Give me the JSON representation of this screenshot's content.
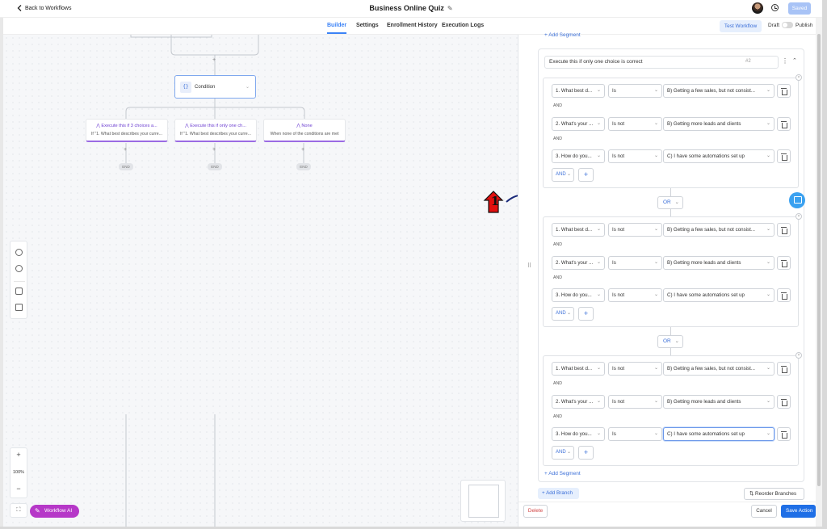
{
  "header": {
    "back_label": "Back to Workflows",
    "title": "Business Online Quiz",
    "saved_label": "Saved"
  },
  "tabs": [
    {
      "label": "Builder",
      "active": true
    },
    {
      "label": "Settings",
      "active": false
    },
    {
      "label": "Enrollment History",
      "active": false
    },
    {
      "label": "Execution Logs",
      "active": false
    }
  ],
  "toolbar": {
    "test_workflow": "Test Workflow",
    "draft": "Draft",
    "publish": "Publish",
    "publish_on": false
  },
  "canvas": {
    "condition_node": {
      "icon": "{}",
      "label": "Condition"
    },
    "branches": [
      {
        "title": "Execute this if 3 choices a...",
        "subtitle": "If \"1. What best describes your curre..."
      },
      {
        "title": "Execute this if only one ch...",
        "subtitle": "If \"1. What best describes your curre..."
      },
      {
        "title": "None",
        "subtitle": "When none of the conditions are met"
      }
    ],
    "end_label": "END",
    "zoom_level": "100%",
    "workflow_ai": "Workflow AI",
    "annotation_number": "1"
  },
  "panel": {
    "add_segment_top": "+ Add Segment",
    "branch_name": "Execute this if only one choice is correct",
    "branch_index": "#2",
    "segments": [
      {
        "rows": [
          {
            "field": "1. What best d...",
            "op": "Is",
            "value": "B) Getting a few sales, but not consist..."
          },
          {
            "field": "2. What's your ...",
            "op": "Is not",
            "value": "B) Getting more leads and clients"
          },
          {
            "field": "3. How do you...",
            "op": "Is not",
            "value": "C) I have some automations set up"
          }
        ]
      },
      {
        "rows": [
          {
            "field": "1. What best d...",
            "op": "Is not",
            "value": "B) Getting a few sales, but not consist..."
          },
          {
            "field": "2. What's your ...",
            "op": "Is",
            "value": "B) Getting more leads and clients"
          },
          {
            "field": "3. How do you...",
            "op": "Is not",
            "value": "C) I have some automations set up"
          }
        ]
      },
      {
        "rows": [
          {
            "field": "1. What best d...",
            "op": "Is not",
            "value": "B) Getting a few sales, but not consist..."
          },
          {
            "field": "2. What's your ...",
            "op": "Is not",
            "value": "B) Getting more leads and clients"
          },
          {
            "field": "3. How do you...",
            "op": "Is",
            "value": "C) I have some automations set up"
          }
        ]
      }
    ],
    "and_label": "AND",
    "or_label": "OR",
    "add_segment_bottom": "+ Add Segment",
    "add_branch": "+ Add Branch",
    "reorder_branches": "Reorder Branches",
    "delete": "Delete",
    "cancel": "Cancel",
    "save_action": "Save Action"
  },
  "colors": {
    "accent": "#3b82f6",
    "branch_purple": "#6d3fd1",
    "save_blue": "#1f6fe6",
    "delete_red": "#d14343",
    "ai_magenta": "#b638c8",
    "annotation_red": "#e10f0f"
  }
}
